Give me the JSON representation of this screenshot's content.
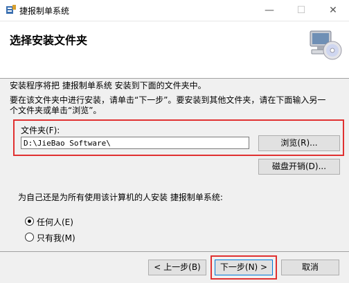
{
  "window": {
    "title": "捷报制单系统",
    "minimize": "—",
    "maximize": "☐",
    "close": "✕"
  },
  "header": {
    "title": "选择安装文件夹",
    "graphic": "computer-cd-icon"
  },
  "body": {
    "line1": "安装程序将把 捷报制单系统 安装到下面的文件夹中。",
    "line2": "要在该文件夹中进行安装，请单击“下一步”。要安装到其他文件夹，请在下面输入另一",
    "line3": "个文件夹或单击“浏览”。"
  },
  "folder": {
    "label": "文件夹(F):",
    "value": "D:\\JieBao Software\\",
    "browse_label": "浏览(R)...",
    "disk_cost_label": "磁盘开销(D)..."
  },
  "install_for": {
    "question": "为自己还是为所有使用该计算机的人安装 捷报制单系统:",
    "options": [
      {
        "label": "任何人(E)",
        "selected": true
      },
      {
        "label": "只有我(M)",
        "selected": false
      }
    ]
  },
  "footer": {
    "back_label": "< 上一步(B)",
    "next_label": "下一步(N) >",
    "cancel_label": "取消"
  },
  "colors": {
    "highlight": "#e03030",
    "focus": "#0078d7"
  }
}
